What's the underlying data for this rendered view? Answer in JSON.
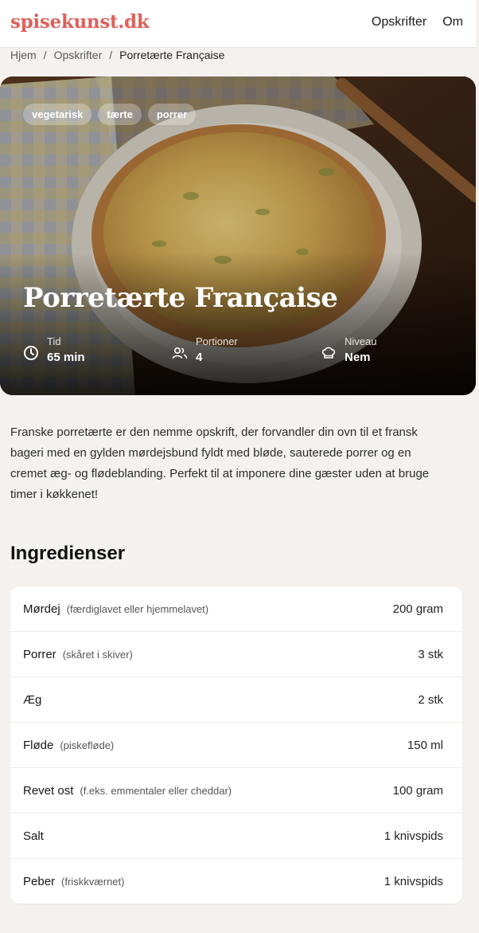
{
  "header": {
    "logo": "spisekunst.dk",
    "nav": [
      "Opskrifter",
      "Om"
    ]
  },
  "breadcrumb": {
    "items": [
      "Hjem",
      "Opskrifter"
    ],
    "current": "Porretærte Française",
    "sep": "/"
  },
  "hero": {
    "tags": [
      "vegetarisk",
      "tærte",
      "porrer"
    ],
    "title": "Porretærte Française",
    "meta": [
      {
        "icon": "clock-icon",
        "label": "Tid",
        "value": "65 min"
      },
      {
        "icon": "users-icon",
        "label": "Portioner",
        "value": "4"
      },
      {
        "icon": "chef-hat-icon",
        "label": "Niveau",
        "value": "Nem"
      }
    ]
  },
  "intro": "Franske porretærte er den nemme opskrift, der forvandler din ovn til et fransk bageri med en gylden mørdejsbund fyldt med bløde, sauterede porrer og en cremet æg- og flødeblanding. Perfekt til at imponere dine gæster uden at bruge timer i køkkenet!",
  "ingredients": {
    "heading": "Ingredienser",
    "items": [
      {
        "name": "Mørdej",
        "note": "(færdiglavet eller hjemmelavet)",
        "qty": "200 gram"
      },
      {
        "name": "Porrer",
        "note": "(skåret i skiver)",
        "qty": "3 stk"
      },
      {
        "name": "Æg",
        "note": "",
        "qty": "2 stk"
      },
      {
        "name": "Fløde",
        "note": "(piskefløde)",
        "qty": "150 ml"
      },
      {
        "name": "Revet ost",
        "note": "(f.eks. emmentaler eller cheddar)",
        "qty": "100 gram"
      },
      {
        "name": "Salt",
        "note": "",
        "qty": "1 knivspids"
      },
      {
        "name": "Peber",
        "note": "(friskkværnet)",
        "qty": "1 knivspids"
      }
    ]
  }
}
